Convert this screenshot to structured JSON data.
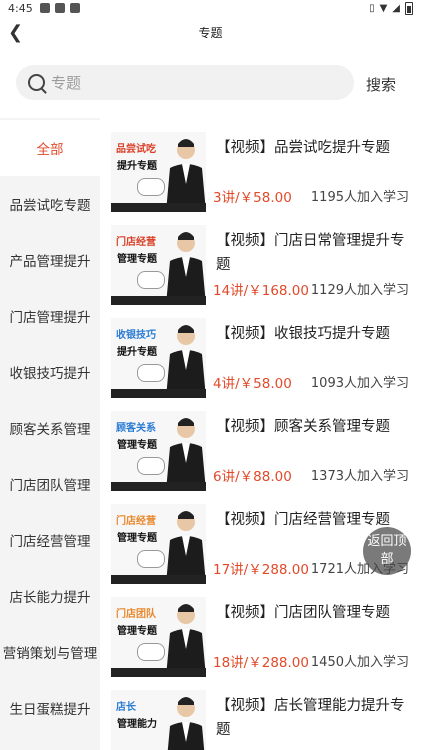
{
  "status": {
    "time": "4:45"
  },
  "nav": {
    "back_icon": "chevron-left-icon",
    "title": "专题"
  },
  "search": {
    "placeholder": "专题",
    "button": "搜索"
  },
  "sidebar": {
    "items": [
      {
        "label": "全部",
        "active": true
      },
      {
        "label": "品尝试吃专题"
      },
      {
        "label": "产品管理提升"
      },
      {
        "label": "门店管理提升"
      },
      {
        "label": "收银技巧提升"
      },
      {
        "label": "顾客关系管理"
      },
      {
        "label": "门店团队管理"
      },
      {
        "label": "门店经营管理"
      },
      {
        "label": "店长能力提升"
      },
      {
        "label": "营销策划与管理"
      },
      {
        "label": "生日蛋糕提升"
      }
    ]
  },
  "courses": [
    {
      "thumb_line1": "品尝试吃",
      "thumb_line2": "提升专题",
      "title": "【视频】品尝试吃提升专题",
      "price": "3讲/￥58.00",
      "learners": "1195人加入学习"
    },
    {
      "thumb_line1": "门店经营",
      "thumb_line2": "管理专题",
      "title": "【视频】门店日常管理提升专题",
      "price": "14讲/￥168.00",
      "learners": "1129人加入学习"
    },
    {
      "thumb_line1": "收银技巧",
      "thumb_line2": "提升专题",
      "title": "【视频】收银技巧提升专题",
      "price": "4讲/￥58.00",
      "learners": "1093人加入学习"
    },
    {
      "thumb_line1": "顾客关系",
      "thumb_line2": "管理专题",
      "title": "【视频】顾客关系管理专题",
      "price": "6讲/￥88.00",
      "learners": "1373人加入学习"
    },
    {
      "thumb_line1": "门店经营",
      "thumb_line2": "管理专题",
      "title": "【视频】门店经营管理专题",
      "price": "17讲/￥288.00",
      "learners": "1721人加入学习"
    },
    {
      "thumb_line1": "门店团队",
      "thumb_line2": "管理专题",
      "title": "【视频】门店团队管理专题",
      "price": "18讲/￥288.00",
      "learners": "1450人加入学习"
    },
    {
      "thumb_line1": "店长",
      "thumb_line2": "管理能力",
      "title": "【视频】店长管理能力提升专题",
      "price": "",
      "learners": ""
    }
  ],
  "float_button": {
    "label": "返回顶部"
  },
  "colors": {
    "accent": "#e24a2a",
    "sidebar_bg": "#f4f4f4"
  }
}
